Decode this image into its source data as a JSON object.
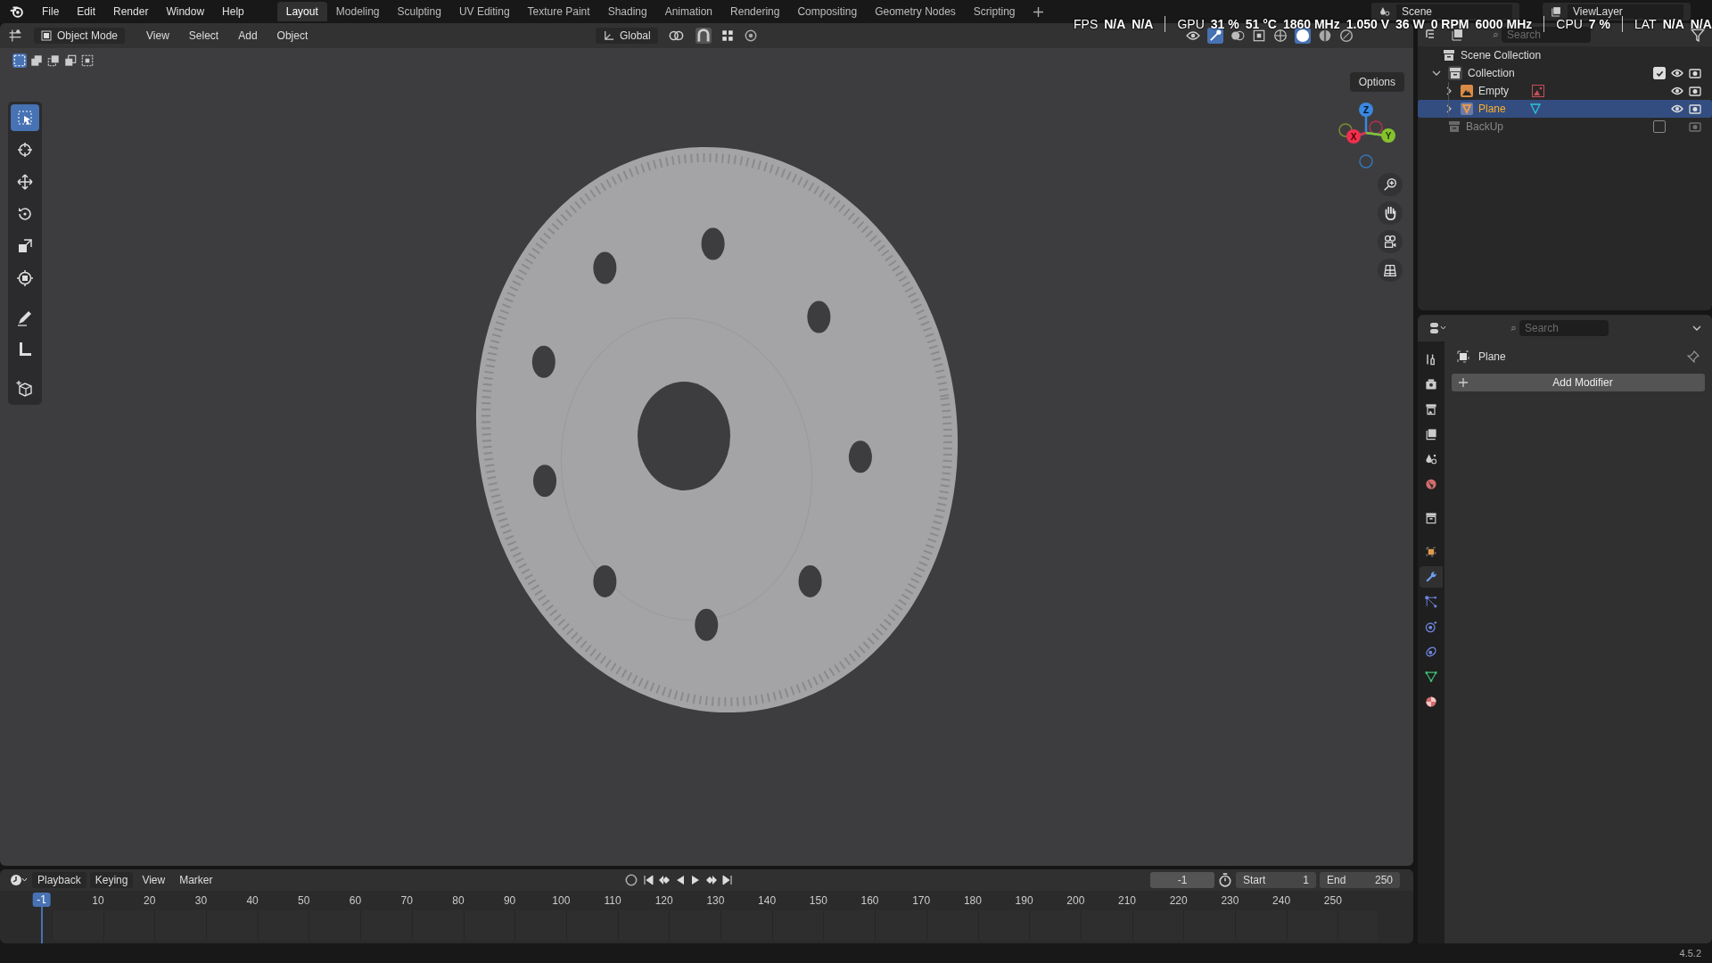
{
  "menu": [
    "File",
    "Edit",
    "Render",
    "Window",
    "Help"
  ],
  "workspaces": [
    {
      "label": "Layout",
      "selected": true
    },
    {
      "label": "Modeling",
      "selected": false
    },
    {
      "label": "Sculpting",
      "selected": false
    },
    {
      "label": "UV Editing",
      "selected": false
    },
    {
      "label": "Texture Paint",
      "selected": false
    },
    {
      "label": "Shading",
      "selected": false
    },
    {
      "label": "Animation",
      "selected": false
    },
    {
      "label": "Rendering",
      "selected": false
    },
    {
      "label": "Compositing",
      "selected": false
    },
    {
      "label": "Geometry Nodes",
      "selected": false
    },
    {
      "label": "Scripting",
      "selected": false
    }
  ],
  "scene": "Scene",
  "view_layer": "ViewLayer",
  "hud": [
    {
      "label": "FPS",
      "values": [
        "N/A",
        "N/A"
      ]
    },
    {
      "label": "GPU",
      "values": [
        "31 %",
        "51 °C",
        "1860 MHz",
        "1.050 V",
        "36 W",
        "0 RPM",
        "6000 MHz"
      ]
    },
    {
      "label": "CPU",
      "values": [
        "7 %"
      ]
    },
    {
      "label": "LAT",
      "values": [
        "N/A",
        "N/A"
      ]
    }
  ],
  "viewport": {
    "mode": "Object Mode",
    "menus": [
      "View",
      "Select",
      "Add",
      "Object"
    ],
    "orientation": "Global",
    "options": "Options",
    "axes": [
      "X",
      "Y",
      "Z"
    ],
    "tools": [
      {
        "kind": "select",
        "selected": true
      },
      {
        "kind": "cursor",
        "selected": false
      },
      {
        "kind": "move",
        "selected": false
      },
      {
        "kind": "rotate",
        "selected": false
      },
      {
        "kind": "scale",
        "selected": false
      },
      {
        "kind": "transform",
        "selected": false
      },
      {
        "kind": "annotate",
        "selected": false
      },
      {
        "kind": "measure",
        "selected": false
      },
      {
        "kind": "add-cube",
        "selected": false
      }
    ]
  },
  "outliner": {
    "search_placeholder": "Search",
    "root": "Scene Collection",
    "items": [
      {
        "label": "Collection",
        "expanded": true,
        "checked": true,
        "selected": false,
        "children": [
          {
            "label": "Empty",
            "kind": "empty",
            "expanded": false,
            "selected": false
          },
          {
            "label": "Plane",
            "kind": "mesh",
            "expanded": false,
            "selected": true
          }
        ]
      },
      {
        "label": "BackUp",
        "checked": false,
        "selected": false
      }
    ]
  },
  "properties": {
    "search_placeholder": "Search",
    "object": "Plane",
    "add_modifier": "Add Modifier",
    "tabs": [
      {
        "kind": "tool",
        "selected": false
      },
      {
        "kind": "render",
        "selected": false
      },
      {
        "kind": "output",
        "selected": false
      },
      {
        "kind": "view-layer",
        "selected": false
      },
      {
        "kind": "scene",
        "selected": false
      },
      {
        "kind": "world",
        "selected": false
      },
      {
        "kind": "collection",
        "selected": false
      },
      {
        "kind": "object",
        "selected": false
      },
      {
        "kind": "modifier",
        "selected": true
      },
      {
        "kind": "particles",
        "selected": false
      },
      {
        "kind": "physics",
        "selected": false
      },
      {
        "kind": "constraints",
        "selected": false
      },
      {
        "kind": "data",
        "selected": false
      },
      {
        "kind": "material",
        "selected": false
      }
    ]
  },
  "timeline": {
    "menus": [
      "Playback",
      "Keying",
      "View",
      "Marker"
    ],
    "current_frame": "-1",
    "start_label": "Start",
    "start": "1",
    "end_label": "End",
    "end": "250",
    "playhead": "-1",
    "ruler": [
      "10",
      "20",
      "30",
      "40",
      "50",
      "60",
      "70",
      "80",
      "90",
      "100",
      "110",
      "120",
      "130",
      "140",
      "150",
      "160",
      "170",
      "180",
      "190",
      "200",
      "210",
      "220",
      "230",
      "240",
      "250"
    ]
  },
  "version": "4.5.2"
}
